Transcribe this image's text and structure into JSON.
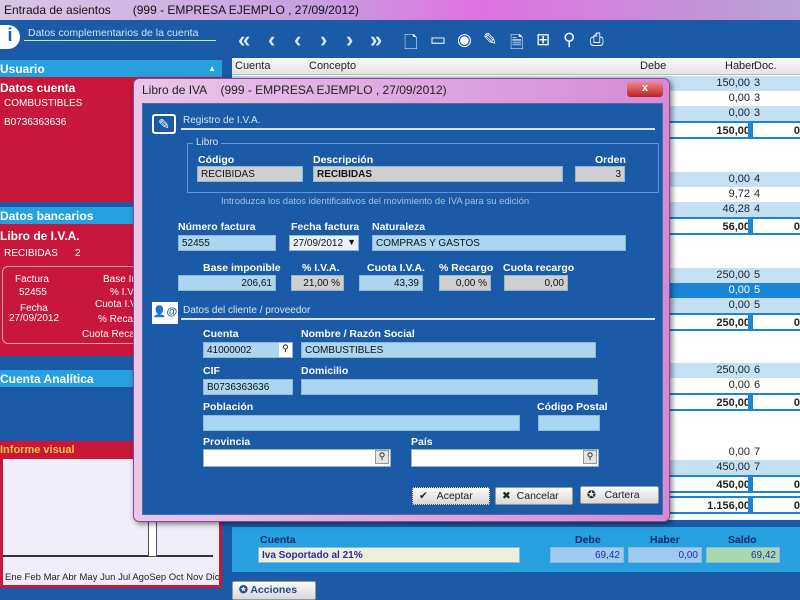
{
  "window": {
    "title": "Entrada de asientos",
    "company": "(999 - EMPRESA EJEMPLO , 27/09/2012)"
  },
  "toolbar": {
    "info_label": "Datos complementarios de la cuenta",
    "nav": [
      "«",
      "‹",
      "‹",
      "›",
      "›",
      "»"
    ]
  },
  "sidebar": {
    "usuario": "Usuario",
    "datos_cuenta": "Datos cuenta",
    "nombre": "COMBUSTIBLES",
    "cif": "B0736363636",
    "datos_bancarios": "Datos bancarios",
    "libro_iva": "Libro de I.V.A.",
    "libro": "RECIBIDAS",
    "libro_n": "2",
    "factura_label": "Factura",
    "factura": "52455",
    "fecha_label": "Fecha",
    "fecha": "27/09/2012",
    "base_label": "Base Im",
    "piva_label": "% I.V",
    "cuota_label": "Cuota I.V",
    "precargo_label": "% Recar",
    "cuotarec_label": "Cuota Recar",
    "analitica": "Cuenta Analítica",
    "informe": "Informe visual",
    "months": [
      "Ene",
      "Feb",
      "Mar",
      "Abr",
      "May",
      "Jun",
      "Jul",
      "Ago",
      "Sep",
      "Oct",
      "Nov",
      "Dic"
    ]
  },
  "grid": {
    "headers": [
      "Cuenta",
      "Concepto",
      "Debe",
      "Haber",
      "Doc."
    ],
    "rows": [
      {
        "h": "150,00",
        "d": "3"
      },
      {
        "h": "0,00",
        "d": "3"
      },
      {
        "h": "0,00",
        "d": "3"
      },
      {
        "total": "150,00",
        "z": "0"
      },
      {
        "h": "0,00",
        "d": "4"
      },
      {
        "h": "9,72",
        "d": "4"
      },
      {
        "h": "46,28",
        "d": "4"
      },
      {
        "total": "56,00",
        "z": "0"
      },
      {
        "h": "250,00",
        "d": "5"
      },
      {
        "h": "0,00",
        "d": "5"
      },
      {
        "h": "0,00",
        "d": "5"
      },
      {
        "total": "250,00",
        "z": "0"
      },
      {
        "h": "250,00",
        "d": "6"
      },
      {
        "h": "0,00",
        "d": "6"
      },
      {
        "total": "250,00",
        "z": "0"
      },
      {
        "h": "0,00",
        "d": "7"
      },
      {
        "h": "450,00",
        "d": "7"
      },
      {
        "total": "450,00",
        "z": "0"
      },
      {
        "total": "1.156,00",
        "z": "0"
      }
    ]
  },
  "summary": {
    "cuenta_label": "Cuenta",
    "cuenta": "Iva Soportado al 21%",
    "debe_label": "Debe",
    "debe": "69,42",
    "haber_label": "Haber",
    "haber": "0,00",
    "saldo_label": "Saldo",
    "saldo": "69,42"
  },
  "acciones": "Acciones",
  "dialog": {
    "title": "Libro de IVA",
    "company": "(999 - EMPRESA EJEMPLO , 27/09/2012)",
    "close": "x",
    "registro": "Registro de I.V.A.",
    "libro_group": "Libro",
    "codigo_label": "Código",
    "codigo": "RECIBIDAS",
    "descripcion_label": "Descripción",
    "descripcion": "RECIBIDAS",
    "orden_label": "Orden",
    "orden": "3",
    "hint": "Introduzca los datos identificativos del movimiento de IVA para su edición",
    "numfact_label": "Número factura",
    "numfact": "52455",
    "fecha_label": "Fecha factura",
    "fecha": "27/09/2012",
    "naturaleza_label": "Naturaleza",
    "naturaleza": "COMPRAS Y GASTOS",
    "base_label": "Base imponible",
    "base": "206,61",
    "piva_label": "% I.V.A.",
    "piva": "21,00 %",
    "cuota_label": "Cuota I.V.A.",
    "cuota": "43,39",
    "precargo_label": "% Recargo",
    "precargo": "0,00 %",
    "cuotarec_label": "Cuota recargo",
    "cuotarec": "0,00",
    "cliente": "Datos del cliente / proveedor",
    "cuenta_label": "Cuenta",
    "cuenta": "41000002",
    "nombre_label": "Nombre / Razón Social",
    "nombre": "COMBUSTIBLES",
    "cif_label": "CIF",
    "cif": "B0736363636",
    "domicilio_label": "Domicilio",
    "domicilio": "",
    "poblacion_label": "Población",
    "poblacion": "",
    "cp_label": "Código Postal",
    "cp": "",
    "provincia_label": "Provincia",
    "provincia": "",
    "pais_label": "País",
    "pais": "",
    "aceptar": "Aceptar",
    "cancelar": "Cancelar",
    "cartera": "Cartera"
  }
}
